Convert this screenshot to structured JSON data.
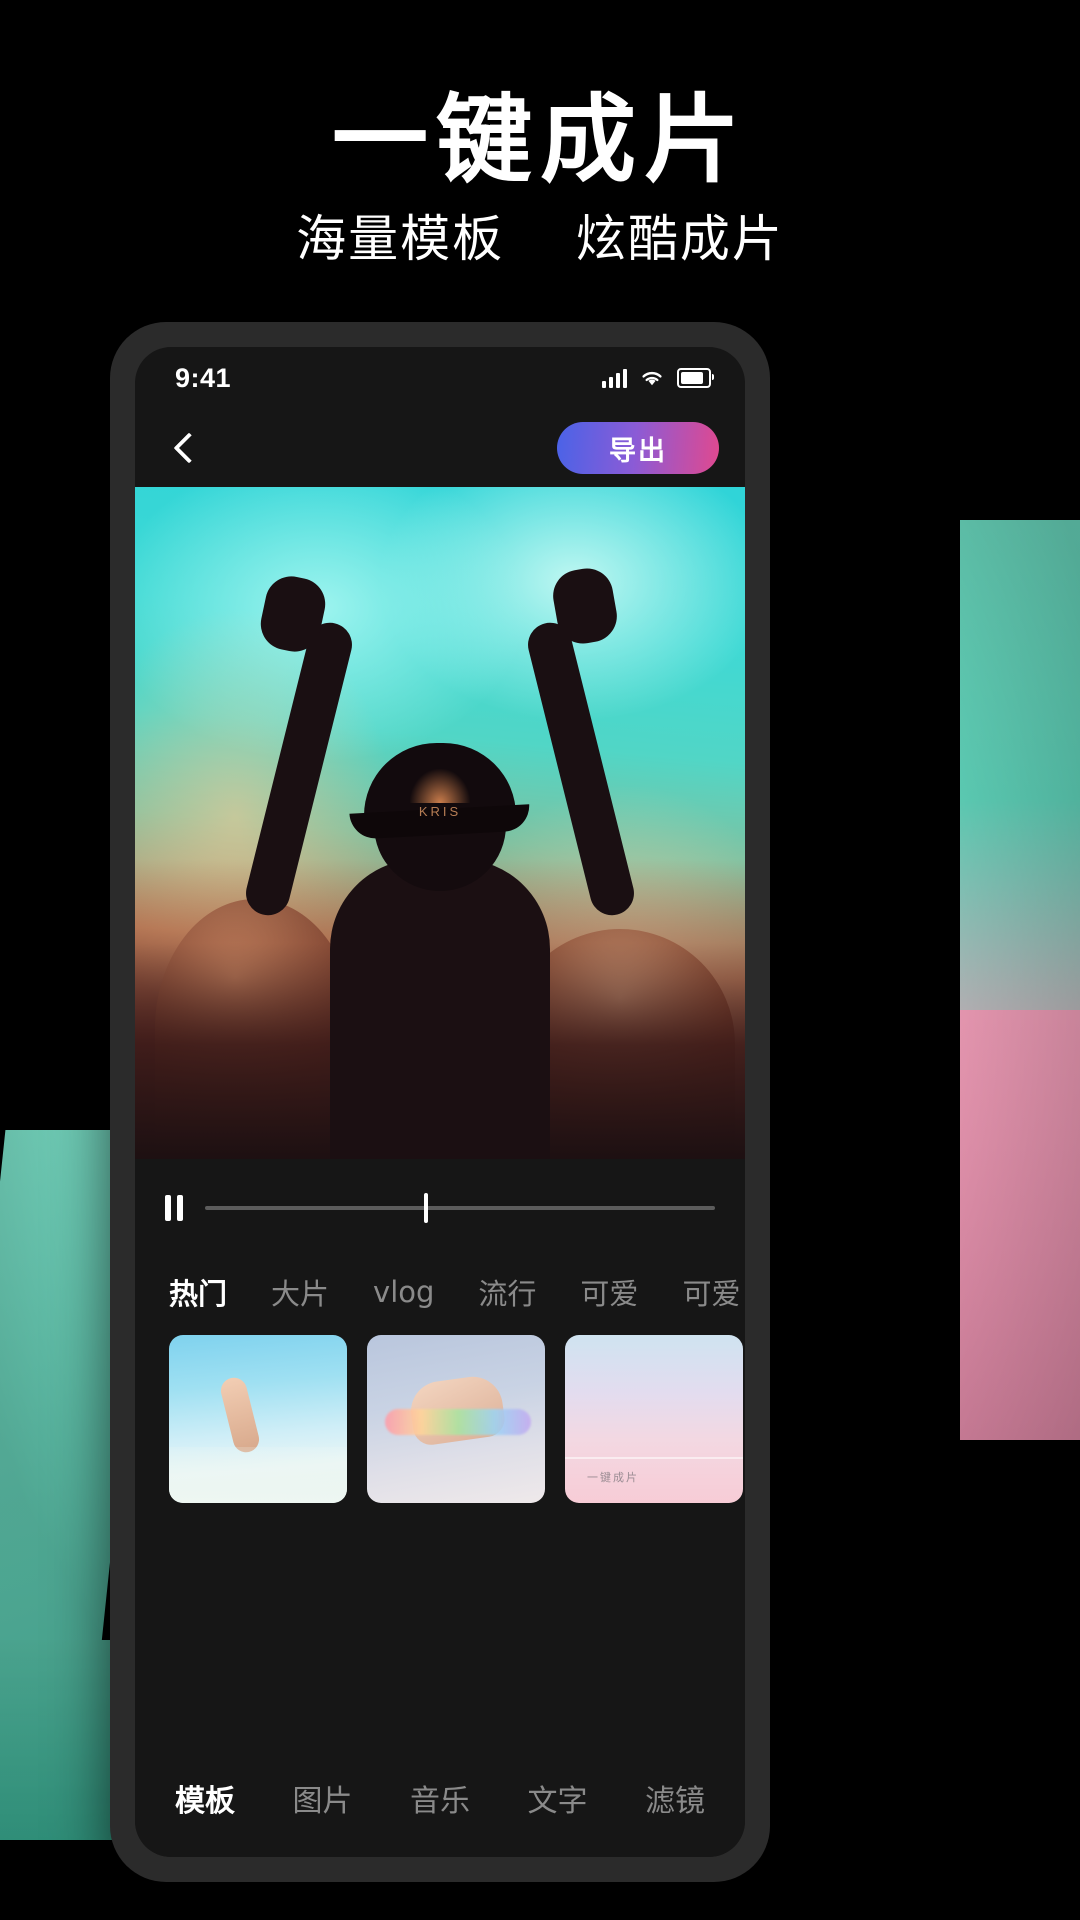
{
  "promo": {
    "title": "一键成片",
    "subtitle_left": "海量模板",
    "subtitle_right": "炫酷成片"
  },
  "colors": {
    "accent_gradient_start": "#4a63e7",
    "accent_gradient_mid": "#8b5bd6",
    "accent_gradient_end": "#e0498f",
    "screen_bg": "#161616",
    "phone_frame": "#2b2b2b",
    "decor_teal": "#63dcc2",
    "decor_pink": "#f4a0bb",
    "active_text": "#ffffff",
    "inactive_text": "#8a8a8a"
  },
  "statusbar": {
    "time": "9:41",
    "signal_icon": "cellular-signal-icon",
    "wifi_icon": "wifi-icon",
    "battery_icon": "battery-icon"
  },
  "navbar": {
    "back_icon": "back-chevron-icon",
    "export_label": "导出"
  },
  "video": {
    "cap_brand": "KRIS"
  },
  "player": {
    "pause_icon": "pause-icon",
    "progress_percent": 43
  },
  "categories": [
    {
      "label": "热门",
      "active": true
    },
    {
      "label": "大片",
      "active": false
    },
    {
      "label": "vlog",
      "active": false
    },
    {
      "label": "流行",
      "active": false
    },
    {
      "label": "可爱",
      "active": false
    },
    {
      "label": "可爱",
      "active": false
    }
  ],
  "templates": [
    {
      "name": "underwater-hand-template"
    },
    {
      "name": "rainbow-hand-template"
    },
    {
      "name": "pink-sky-template",
      "caption": "一键成片"
    },
    {
      "name": "mountain-template"
    }
  ],
  "bottom_nav": [
    {
      "label": "模板",
      "active": true
    },
    {
      "label": "图片",
      "active": false
    },
    {
      "label": "音乐",
      "active": false
    },
    {
      "label": "文字",
      "active": false
    },
    {
      "label": "滤镜",
      "active": false
    }
  ]
}
